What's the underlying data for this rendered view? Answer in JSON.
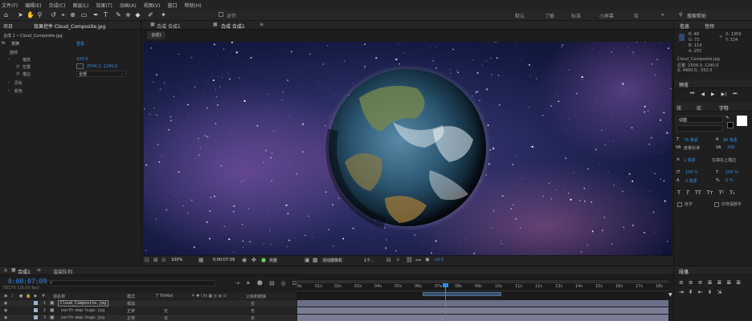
{
  "menu": [
    "文件(F)",
    "编辑(E)",
    "合成(C)",
    "图层(L)",
    "效果(T)",
    "动画(A)",
    "视图(V)",
    "窗口",
    "帮助(H)"
  ],
  "toolbar": {
    "align_label": "对齐",
    "workspaces": [
      "默认",
      "了解",
      "标准",
      "小屏幕",
      "库"
    ],
    "search_placeholder": "搜索帮助"
  },
  "left_panel": {
    "tab_project": "项目",
    "tab_effects": "效果控件 Cloud_Composite.jpg",
    "layer_path": "合成 1 • Cloud_Composite.jpg",
    "transform_label": "变换",
    "reset_label": "重置",
    "properties": [
      {
        "name": "旋转",
        "value": ""
      },
      {
        "name": "缩放",
        "value": "100.0"
      },
      {
        "name": "位置",
        "value": "2504.3, 1240.0"
      },
      {
        "name": "描边",
        "value": "全部"
      },
      {
        "name": "羽化",
        "value": ""
      },
      {
        "name": "颜色",
        "value": ""
      }
    ]
  },
  "viewer": {
    "comp_tab": "合成 合成1",
    "comp_tab2": "合成 合成1",
    "breadcrumb": "合成1",
    "zoom": "100%",
    "timecode": "0:00:07:09",
    "quality": "完整",
    "camera": "活动摄像机",
    "views": "1个...",
    "exposure": "+0.0"
  },
  "info_panel": {
    "tab_info": "信息",
    "tab_audio": "音频",
    "color_values": [
      "R: 48",
      "G: 72",
      "B: 114",
      "A: 255"
    ],
    "coords": [
      "X: 1359",
      "Y: 324"
    ],
    "layer_name": "Cloud_Composite.jpg",
    "position_line": "位置: 2504.0, 1240.0",
    "delta_line": "Δ: 4960.0, -352.0"
  },
  "preview_panel": {
    "title": "预览"
  },
  "character_panel": {
    "tabs": [
      "效",
      "库",
      "字符"
    ],
    "font_name": "幼圆",
    "font_size": "76 像素",
    "leading": "90 像素",
    "kerning": "度量标准",
    "tracking": "200",
    "stroke_option": "在填充上描边",
    "stroke_width": "1 像素",
    "vertical_scale": "100 %",
    "horizontal_scale": "100 %",
    "baseline": "0 像素",
    "tsume": "0 %",
    "style_buttons": [
      "T",
      "T",
      "TT",
      "Tт",
      "T¹",
      "T₁"
    ],
    "ligatures": "连字",
    "hindi_digits": "印地语数字"
  },
  "paragraph_panel": {
    "title": "段落"
  },
  "timeline": {
    "tab_comp": "合成1",
    "tab_queue": "渲染队列",
    "timecode": "0:00:07:09",
    "frames": "00175 (25.00 fps)",
    "header": {
      "num": "#",
      "source": "源名称",
      "mode": "模式",
      "trkmat": "T TrkMat",
      "parent": "父级和链接"
    },
    "layers": [
      {
        "num": "1",
        "name": "Cloud_Composite.jpg",
        "mode": "相加",
        "trkmat": "",
        "parent": "无"
      },
      {
        "num": "2",
        "name": "earth-map-huge.jpg",
        "mode": "正常",
        "trkmat": "无",
        "parent": "无"
      },
      {
        "num": "3",
        "name": "earth-map-huge.jpg",
        "mode": "正常",
        "trkmat": "无",
        "parent": "无"
      }
    ],
    "ruler": [
      "0s",
      "01s",
      "02s",
      "03s",
      "04s",
      "05s",
      "06s",
      "07s",
      "08s",
      "09s",
      "10s",
      "11s",
      "12s",
      "13s",
      "14s",
      "15s",
      "16s",
      "17s",
      "18s"
    ]
  },
  "colors": {
    "accent": "#2d8ceb",
    "bg": "#1e1e1e",
    "panel": "#232323",
    "space": "#171a3e"
  }
}
